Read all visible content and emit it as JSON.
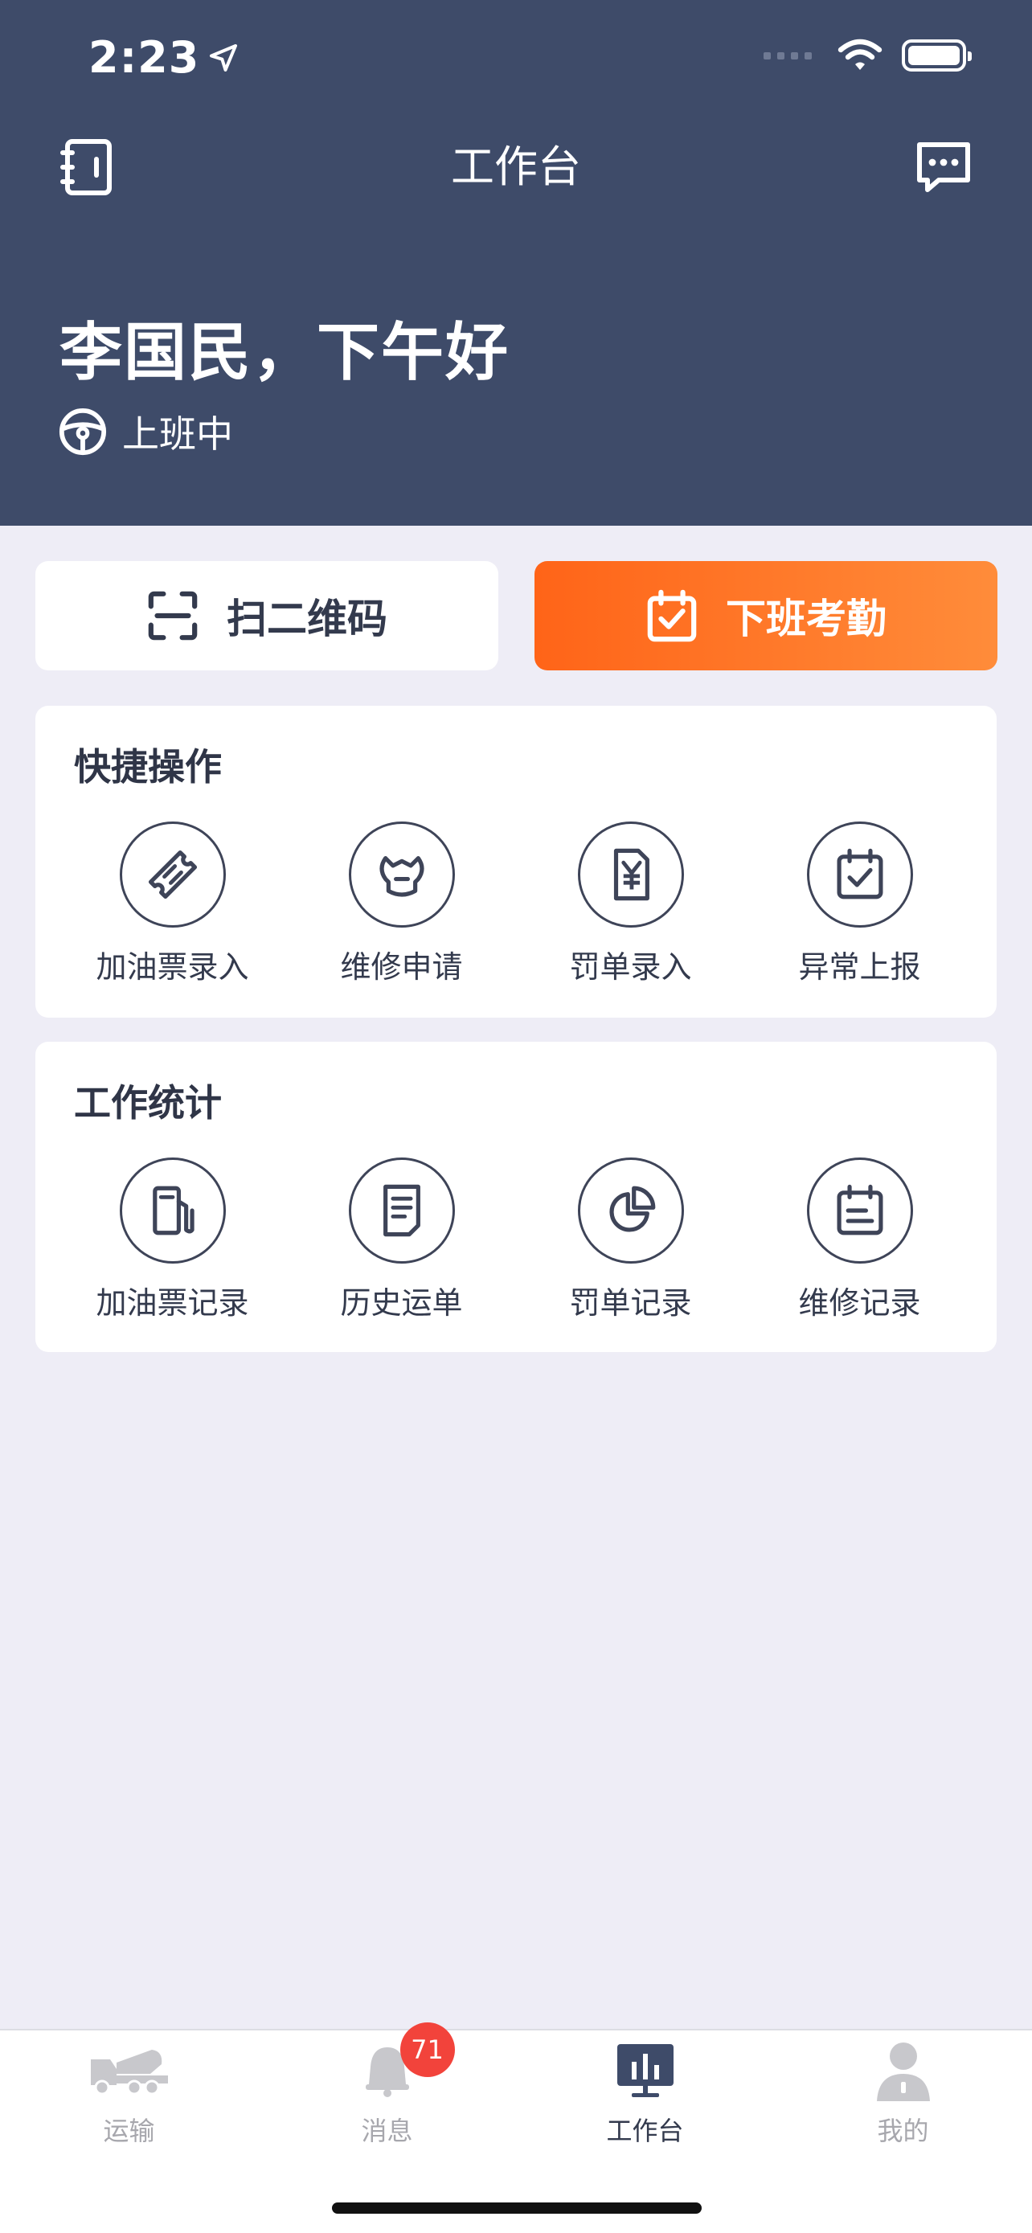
{
  "status_bar": {
    "time": "2:23"
  },
  "nav": {
    "title": "工作台"
  },
  "greeting": "李国民，下午好",
  "duty_status": "上班中",
  "actions": {
    "scan_label": "扫二维码",
    "checkout_label": "下班考勤"
  },
  "quick_ops": {
    "title": "快捷操作",
    "items": [
      {
        "label": "加油票录入",
        "icon": "ticket-icon"
      },
      {
        "label": "维修申请",
        "icon": "wrench-icon"
      },
      {
        "label": "罚单录入",
        "icon": "yen-document-icon"
      },
      {
        "label": "异常上报",
        "icon": "calendar-check-icon"
      }
    ]
  },
  "work_stats": {
    "title": "工作统计",
    "items": [
      {
        "label": "加油票记录",
        "icon": "fuel-pump-icon"
      },
      {
        "label": "历史运单",
        "icon": "document-icon"
      },
      {
        "label": "罚单记录",
        "icon": "pie-chart-icon"
      },
      {
        "label": "维修记录",
        "icon": "calendar-list-icon"
      }
    ]
  },
  "tabbar": {
    "items": [
      {
        "label": "运输",
        "icon": "truck-icon"
      },
      {
        "label": "消息",
        "icon": "bell-icon",
        "badge": "71"
      },
      {
        "label": "工作台",
        "icon": "dashboard-icon",
        "active": true
      },
      {
        "label": "我的",
        "icon": "user-icon"
      }
    ]
  },
  "colors": {
    "header": "#3e4b69",
    "accent_start": "#ff6418",
    "accent_end": "#ff8c3a",
    "badge": "#f2433b",
    "background": "#eeedf6"
  }
}
